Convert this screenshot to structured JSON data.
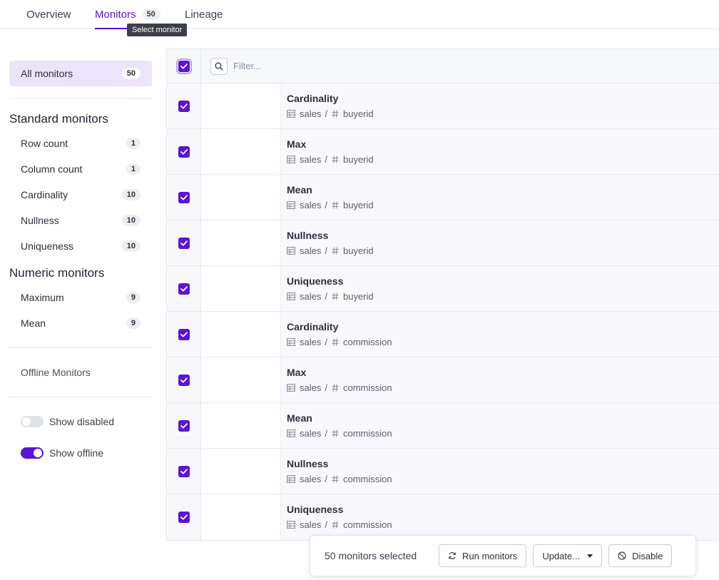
{
  "tabs": [
    {
      "label": "Overview"
    },
    {
      "label": "Monitors",
      "badge": "50"
    },
    {
      "label": "Lineage"
    }
  ],
  "tooltip": "Select monitor",
  "sidebar": {
    "all": {
      "label": "All monitors",
      "count": "50"
    },
    "standard_title": "Standard monitors",
    "standard": [
      {
        "label": "Row count",
        "count": "1"
      },
      {
        "label": "Column count",
        "count": "1"
      },
      {
        "label": "Cardinality",
        "count": "10"
      },
      {
        "label": "Nullness",
        "count": "10"
      },
      {
        "label": "Uniqueness",
        "count": "10"
      }
    ],
    "numeric_title": "Numeric monitors",
    "numeric": [
      {
        "label": "Maximum",
        "count": "9"
      },
      {
        "label": "Mean",
        "count": "9"
      }
    ],
    "offline_label": "Offline Monitors",
    "toggles": [
      {
        "label": "Show disabled",
        "on": false
      },
      {
        "label": "Show offline",
        "on": true
      }
    ]
  },
  "table": {
    "filter_placeholder": "Filter...",
    "rows": [
      {
        "title": "Cardinality",
        "table": "sales",
        "column": "buyerid"
      },
      {
        "title": "Max",
        "table": "sales",
        "column": "buyerid"
      },
      {
        "title": "Mean",
        "table": "sales",
        "column": "buyerid"
      },
      {
        "title": "Nullness",
        "table": "sales",
        "column": "buyerid"
      },
      {
        "title": "Uniqueness",
        "table": "sales",
        "column": "buyerid"
      },
      {
        "title": "Cardinality",
        "table": "sales",
        "column": "commission"
      },
      {
        "title": "Max",
        "table": "sales",
        "column": "commission"
      },
      {
        "title": "Mean",
        "table": "sales",
        "column": "commission"
      },
      {
        "title": "Nullness",
        "table": "sales",
        "column": "commission"
      },
      {
        "title": "Uniqueness",
        "table": "sales",
        "column": "commission"
      }
    ]
  },
  "actionbar": {
    "selected_text": "50 monitors selected",
    "run_label": "Run monitors",
    "update_label": "Update...",
    "disable_label": "Disable"
  },
  "colors": {
    "accent": "#5b14d8",
    "selected_bg": "#ece4fb"
  }
}
